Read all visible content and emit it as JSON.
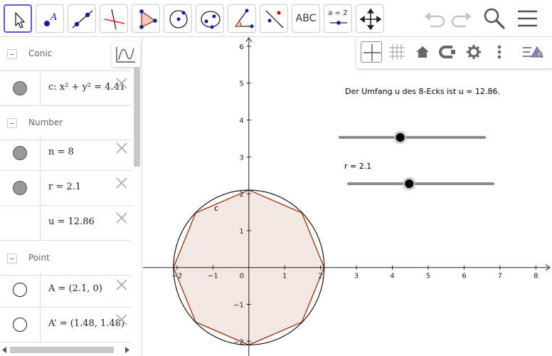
{
  "toolbar": {
    "tools": [
      {
        "name": "move-tool",
        "icon": "cursor-arrow-icon",
        "active": true
      },
      {
        "name": "point-tool",
        "icon": "point-icon"
      },
      {
        "name": "line-tool",
        "icon": "line-through-points-icon"
      },
      {
        "name": "perpendicular-line-tool",
        "icon": "perpendicular-line-icon"
      },
      {
        "name": "polygon-tool",
        "icon": "polygon-icon"
      },
      {
        "name": "circle-tool",
        "icon": "circle-center-point-icon"
      },
      {
        "name": "conic-tool",
        "icon": "ellipse-icon"
      },
      {
        "name": "angle-tool",
        "icon": "angle-icon"
      },
      {
        "name": "reflect-tool",
        "icon": "reflect-line-icon"
      },
      {
        "name": "text-tool",
        "label": "ABC"
      },
      {
        "name": "slider-tool",
        "label": "a = 2"
      },
      {
        "name": "move-graphics-tool",
        "icon": "move-arrows-icon"
      }
    ],
    "undo_icon": "undo-icon",
    "redo_icon": "redo-icon",
    "search_icon": "search-icon",
    "menu_icon": "hamburger-menu-icon"
  },
  "algebra": {
    "graph_button_icon": "graph-icon",
    "sections": {
      "conic": "Conic",
      "number": "Number",
      "point": "Point"
    },
    "rows": {
      "c": "c: x² + y² = 4.41",
      "n": "n = 8",
      "r": "r = 2.1",
      "u": "u = 12.86",
      "A": "A = (2.1, 0)",
      "A_prime": "A’ = (1.48, 1.48)"
    }
  },
  "graphics": {
    "style_bar_icons": [
      "axes-icon",
      "grid-icon",
      "home-icon",
      "point-capture-icon",
      "settings-gear-icon",
      "more-vert-icon",
      "style-bar-toggle-icon"
    ],
    "text_perimeter": "Der Umfang u des 8-Ecks ist u = 12.86.",
    "circle_label": "c",
    "slider_r_label": "r = 2.1",
    "colors": {
      "polygon_stroke": "#993300",
      "polygon_fill": "#f3e7e3",
      "circle": "#000000",
      "slider": "#8c8c8c",
      "accent": "#6557d2"
    }
  },
  "chart_data": {
    "type": "scatter",
    "x_ticks": [
      "-2",
      "-1",
      "0",
      "1",
      "2",
      "3",
      "4",
      "5",
      "6",
      "7",
      "8"
    ],
    "y_ticks": [
      "-2",
      "-1",
      "1",
      "2",
      "3",
      "4",
      "5",
      "6"
    ],
    "xlim": [
      -2.95,
      8.45
    ],
    "ylim": [
      -2.4,
      6.25
    ],
    "circle": {
      "cx": 0,
      "cy": 0,
      "r": 2.1
    },
    "octagon_vertices": [
      [
        2.1,
        0
      ],
      [
        1.48,
        1.48
      ],
      [
        0,
        2.1
      ],
      [
        -1.48,
        1.48
      ],
      [
        -2.1,
        0
      ],
      [
        -1.48,
        -1.48
      ],
      [
        0,
        -2.1
      ],
      [
        1.48,
        -1.48
      ]
    ],
    "sliders": {
      "n": {
        "value": 8,
        "min": 3,
        "max": 15
      },
      "r": {
        "value": 2.1,
        "min": 0,
        "max": 5
      }
    }
  }
}
